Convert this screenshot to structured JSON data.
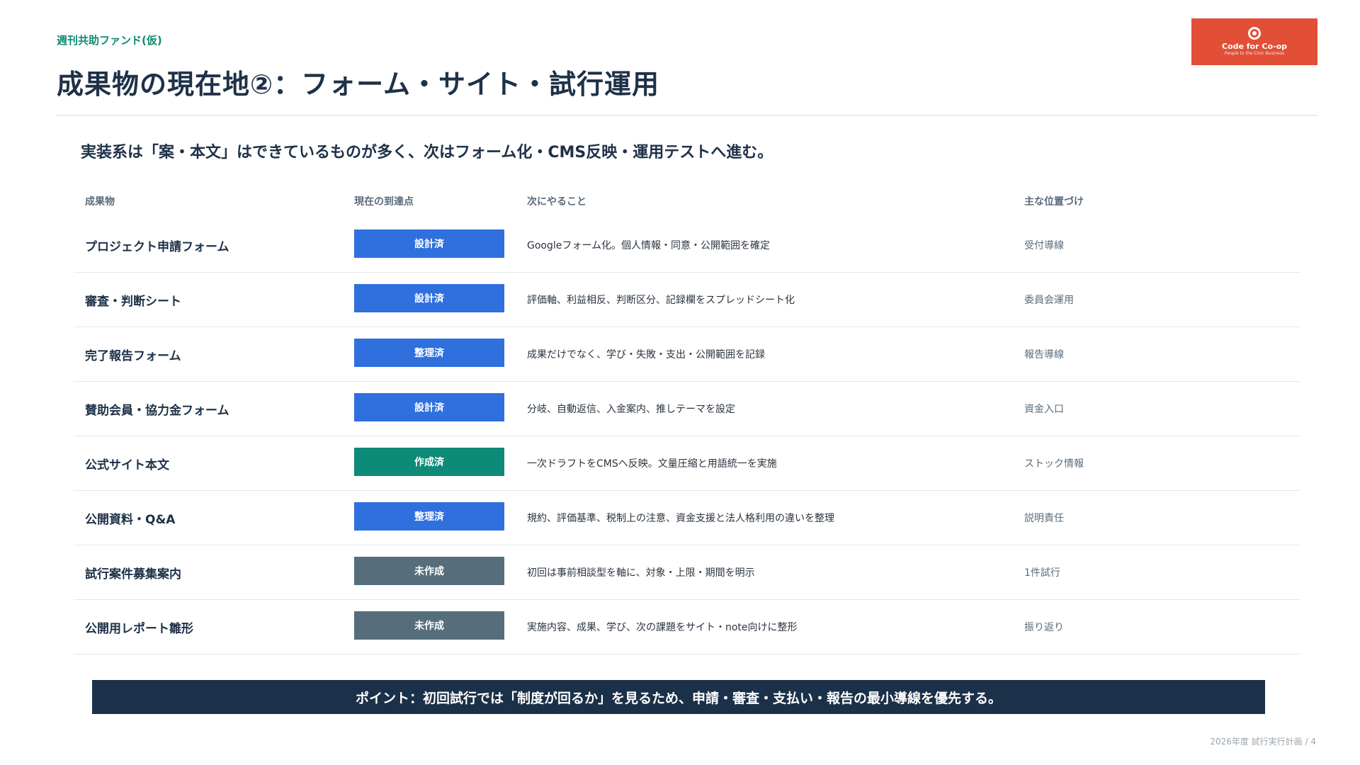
{
  "header": {
    "kicker": "週刊共助ファンド(仮)",
    "title": "成果物の現在地②：フォーム・サイト・試行運用"
  },
  "logo": {
    "name": "Code for Co-op",
    "tagline": "People to the Civic Business",
    "color": "#e24f36"
  },
  "lead": "実装系は「案・本文」はできているものが多く、次はフォーム化・CMS反映・運用テストへ進む。",
  "table": {
    "headers": [
      "成果物",
      "現在の到達点",
      "次にやること",
      "主な位置づけ"
    ],
    "status_colors": {
      "設計済": "#2f6fde",
      "整理済": "#2f6fde",
      "作成済": "#0e8a78",
      "未作成": "#566e7b"
    },
    "rows": [
      {
        "name": "プロジェクト申請フォーム",
        "status": "設計済",
        "next": "Googleフォーム化。個人情報・同意・公開範囲を確定",
        "position": "受付導線"
      },
      {
        "name": "審査・判断シート",
        "status": "設計済",
        "next": "評価軸、利益相反、判断区分、記録欄をスプレッドシート化",
        "position": "委員会運用"
      },
      {
        "name": "完了報告フォーム",
        "status": "整理済",
        "next": "成果だけでなく、学び・失敗・支出・公開範囲を記録",
        "position": "報告導線"
      },
      {
        "name": "賛助会員・協力金フォーム",
        "status": "設計済",
        "next": "分岐、自動返信、入金案内、推しテーマを設定",
        "position": "資金入口"
      },
      {
        "name": "公式サイト本文",
        "status": "作成済",
        "next": "一次ドラフトをCMSへ反映。文量圧縮と用語統一を実施",
        "position": "ストック情報"
      },
      {
        "name": "公開資料・Q&A",
        "status": "整理済",
        "next": "規約、評価基準、税制上の注意、資金支援と法人格利用の違いを整理",
        "position": "説明責任"
      },
      {
        "name": "試行案件募集案内",
        "status": "未作成",
        "next": "初回は事前相談型を軸に、対象・上限・期間を明示",
        "position": "1件試行"
      },
      {
        "name": "公開用レポート雛形",
        "status": "未作成",
        "next": "実施内容、成果、学び、次の課題をサイト・note向けに整形",
        "position": "振り返り"
      }
    ]
  },
  "banner": "ポイント：初回試行では「制度が回るか」を見るため、申請・審査・支払い・報告の最小導線を優先する。",
  "footer": "2026年度 試行実行計画 / 4"
}
